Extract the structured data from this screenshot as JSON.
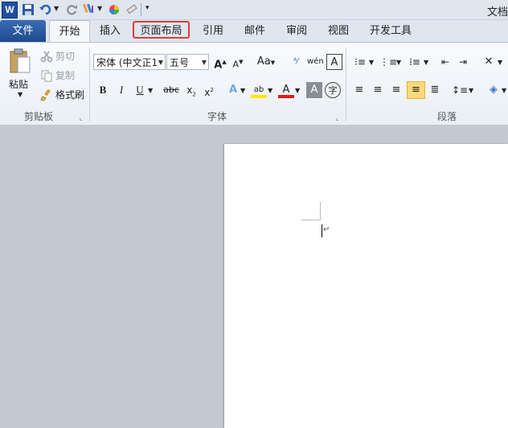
{
  "window": {
    "title": "文档"
  },
  "tabs": [
    {
      "label": "文件"
    },
    {
      "label": "开始"
    },
    {
      "label": "插入"
    },
    {
      "label": "页面布局"
    },
    {
      "label": "引用"
    },
    {
      "label": "邮件"
    },
    {
      "label": "审阅"
    },
    {
      "label": "视图"
    },
    {
      "label": "开发工具"
    }
  ],
  "clipboard": {
    "paste": "粘贴",
    "cut": "剪切",
    "copy": "复制",
    "format_painter": "格式刷",
    "group_label": "剪贴板"
  },
  "font": {
    "name": "宋体 (中文正1",
    "size": "五号",
    "group_label": "字体"
  },
  "paragraph": {
    "group_label": "段落"
  },
  "colors": {
    "file_tab": "#2b5797",
    "highlight_box": "#e03b3b",
    "selected_button": "#fbd97b"
  }
}
